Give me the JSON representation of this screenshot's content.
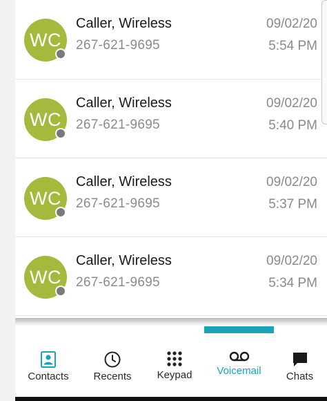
{
  "colors": {
    "avatar_background": "#a3ba3c",
    "accent": "#1ba3b8",
    "presence_status": "#7a7a7a"
  },
  "voicemails": [
    {
      "initials": "WC",
      "name": "Caller, Wireless",
      "number": "267-621-9695",
      "date": "09/02/20",
      "time": "5:54 PM"
    },
    {
      "initials": "WC",
      "name": "Caller, Wireless",
      "number": "267-621-9695",
      "date": "09/02/20",
      "time": "5:40 PM"
    },
    {
      "initials": "WC",
      "name": "Caller, Wireless",
      "number": "267-621-9695",
      "date": "09/02/20",
      "time": "5:37 PM"
    },
    {
      "initials": "WC",
      "name": "Caller, Wireless",
      "number": "267-621-9695",
      "date": "09/02/20",
      "time": "5:34 PM"
    }
  ],
  "tabs": [
    {
      "label": "Contacts",
      "icon": "contacts-icon",
      "active": false
    },
    {
      "label": "Recents",
      "icon": "clock-icon",
      "active": false
    },
    {
      "label": "Keypad",
      "icon": "keypad-icon",
      "active": false
    },
    {
      "label": "Voicemail",
      "icon": "voicemail-icon",
      "active": true
    },
    {
      "label": "Chats",
      "icon": "chat-bubble-icon",
      "active": false
    }
  ]
}
